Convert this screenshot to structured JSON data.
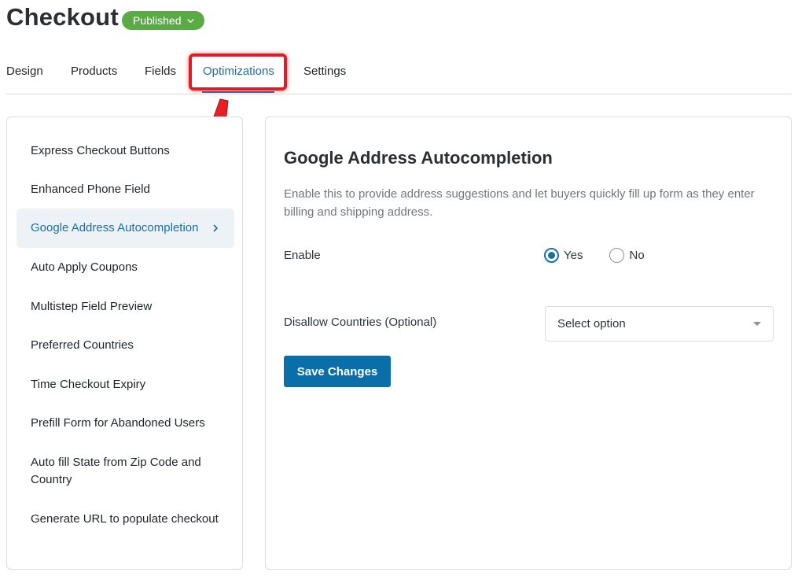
{
  "header": {
    "title": "Checkout",
    "status": "Published"
  },
  "tabs": [
    {
      "label": "Design"
    },
    {
      "label": "Products"
    },
    {
      "label": "Fields"
    },
    {
      "label": "Optimizations",
      "active": true
    },
    {
      "label": "Settings"
    }
  ],
  "sidebar": {
    "items": [
      {
        "label": "Express Checkout Buttons"
      },
      {
        "label": "Enhanced Phone Field"
      },
      {
        "label": "Google Address Autocompletion",
        "active": true
      },
      {
        "label": "Auto Apply Coupons"
      },
      {
        "label": "Multistep Field Preview"
      },
      {
        "label": "Preferred Countries"
      },
      {
        "label": "Time Checkout Expiry"
      },
      {
        "label": "Prefill Form for Abandoned Users"
      },
      {
        "label": "Auto fill State from Zip Code and Country"
      },
      {
        "label": "Generate URL to populate checkout"
      }
    ]
  },
  "panel": {
    "title": "Google Address Autocompletion",
    "description": "Enable this to provide address suggestions and let buyers quickly fill up form as they enter billing and shipping address.",
    "enable": {
      "label": "Enable",
      "options": [
        "Yes",
        "No"
      ],
      "selected": "Yes"
    },
    "disallow": {
      "label": "Disallow Countries (Optional)",
      "placeholder": "Select option"
    },
    "save_label": "Save Changes"
  },
  "colors": {
    "accent": "#1a6fa3",
    "published_badge": "#5aab46",
    "button": "#0a6ea8",
    "annotation_red": "#e31b23"
  }
}
